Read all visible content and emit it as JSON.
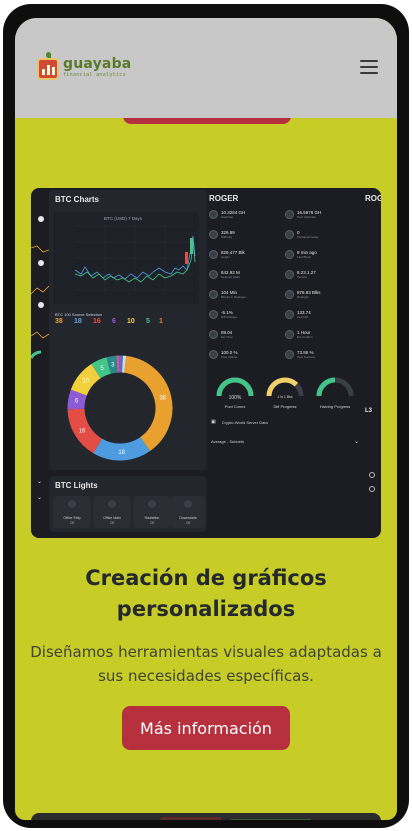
{
  "brand": {
    "name": "guayaba",
    "tagline": "financial analytics",
    "colors": {
      "leaf": "#4f8a2a",
      "box": "#d04a35",
      "text": "#5a7a2a"
    }
  },
  "header": {
    "menu_icon": "hamburger-icon"
  },
  "theme": {
    "background": "#c8cc26",
    "header_bg": "#c8c8c8",
    "accent": "#b7303e",
    "dashboard_bg": "#1b1d22"
  },
  "dashboard": {
    "btc_charts_title": "BTC Charts",
    "roger_title": "ROGER",
    "roger_partial_title": "ROG",
    "btc_lights_title": "BTC Lights",
    "chart_caption": "BTC (USD) 7 Days",
    "stats_caption": "BTC 100 Source Selection",
    "stats": [
      {
        "value": "38",
        "color": "#e8a33a"
      },
      {
        "value": "18",
        "color": "#5aa9e6"
      },
      {
        "value": "16",
        "color": "#e8524a"
      },
      {
        "value": "6",
        "color": "#9a5ad8"
      },
      {
        "value": "10",
        "color": "#f2d04a"
      },
      {
        "value": "5",
        "color": "#4ac48a"
      },
      {
        "value": "1",
        "color": "#e87a3a"
      }
    ],
    "donut": {
      "segments": [
        {
          "label": "38",
          "value": 38,
          "color": "#e8a02e"
        },
        {
          "label": "18",
          "value": 18,
          "color": "#4e9be0"
        },
        {
          "label": "16",
          "value": 16,
          "color": "#e44d45"
        },
        {
          "label": "6",
          "value": 6,
          "color": "#8e5bd6"
        },
        {
          "label": "10",
          "value": 10,
          "color": "#f2cf3c"
        },
        {
          "label": "5",
          "value": 5,
          "color": "#43c488"
        },
        {
          "label": "3",
          "value": 3,
          "color": "#2a8a8a"
        },
        {
          "label": "",
          "value": 1,
          "color": "#c85a9a"
        },
        {
          "label": "",
          "value": 1,
          "color": "#5a6ad8"
        },
        {
          "label": "",
          "value": 1,
          "color": "#d8d8d8"
        }
      ]
    },
    "roger_items": [
      {
        "value": "10.3284 GH",
        "label": "Hashrate"
      },
      {
        "value": "16.5978 GH",
        "label": "Pool Hashrate"
      },
      {
        "value": "326.89",
        "label": "Difficulty"
      },
      {
        "value": "0",
        "label": "Orphaned today"
      },
      {
        "value": "829,477 Blk",
        "label": "Height"
      },
      {
        "value": "9 min ago",
        "label": "Last Block"
      },
      {
        "value": "842.92 M",
        "label": "Network Hash"
      },
      {
        "value": "8.23.1.27",
        "label": "Version"
      },
      {
        "value": "104 Min",
        "label": "Blocks to Retarget"
      },
      {
        "value": "878.93 Blks",
        "label": "Retarget"
      },
      {
        "value": "-5.1%",
        "label": "Diff Change"
      },
      {
        "value": "133.74",
        "label": "Last Diff"
      },
      {
        "value": "89.04",
        "label": "Est Time"
      },
      {
        "value": "1 Hour",
        "label": "Est Confirm"
      },
      {
        "value": "100.0 %",
        "label": "Pool Uptime"
      },
      {
        "value": "73.86 %",
        "label": "Pool Success"
      }
    ],
    "gauges": [
      {
        "value": "100%",
        "label": "Pool Connx",
        "color": "#43c488",
        "fill": 1.0
      },
      {
        "value": "1 in 1 Bks",
        "label": "Diff Progress",
        "color": "#f2cf6a",
        "fill": 0.75
      },
      {
        "value": "",
        "label": "Halving Progress",
        "color": "#43c488",
        "fill": 0.5
      }
    ],
    "server_line": "Crypto-World Server Data",
    "dropdown_label": "Average - Subnets",
    "light_cards": [
      "Office Strip",
      "Office Main",
      "Radiation",
      "Downstairs"
    ],
    "light_card_state": "Off"
  },
  "content": {
    "title": "Creación de gráficos personalizados",
    "description": "Diseñamos herramientas visuales adaptadas a sus necesidades específicas.",
    "cta_label": "Más información"
  }
}
